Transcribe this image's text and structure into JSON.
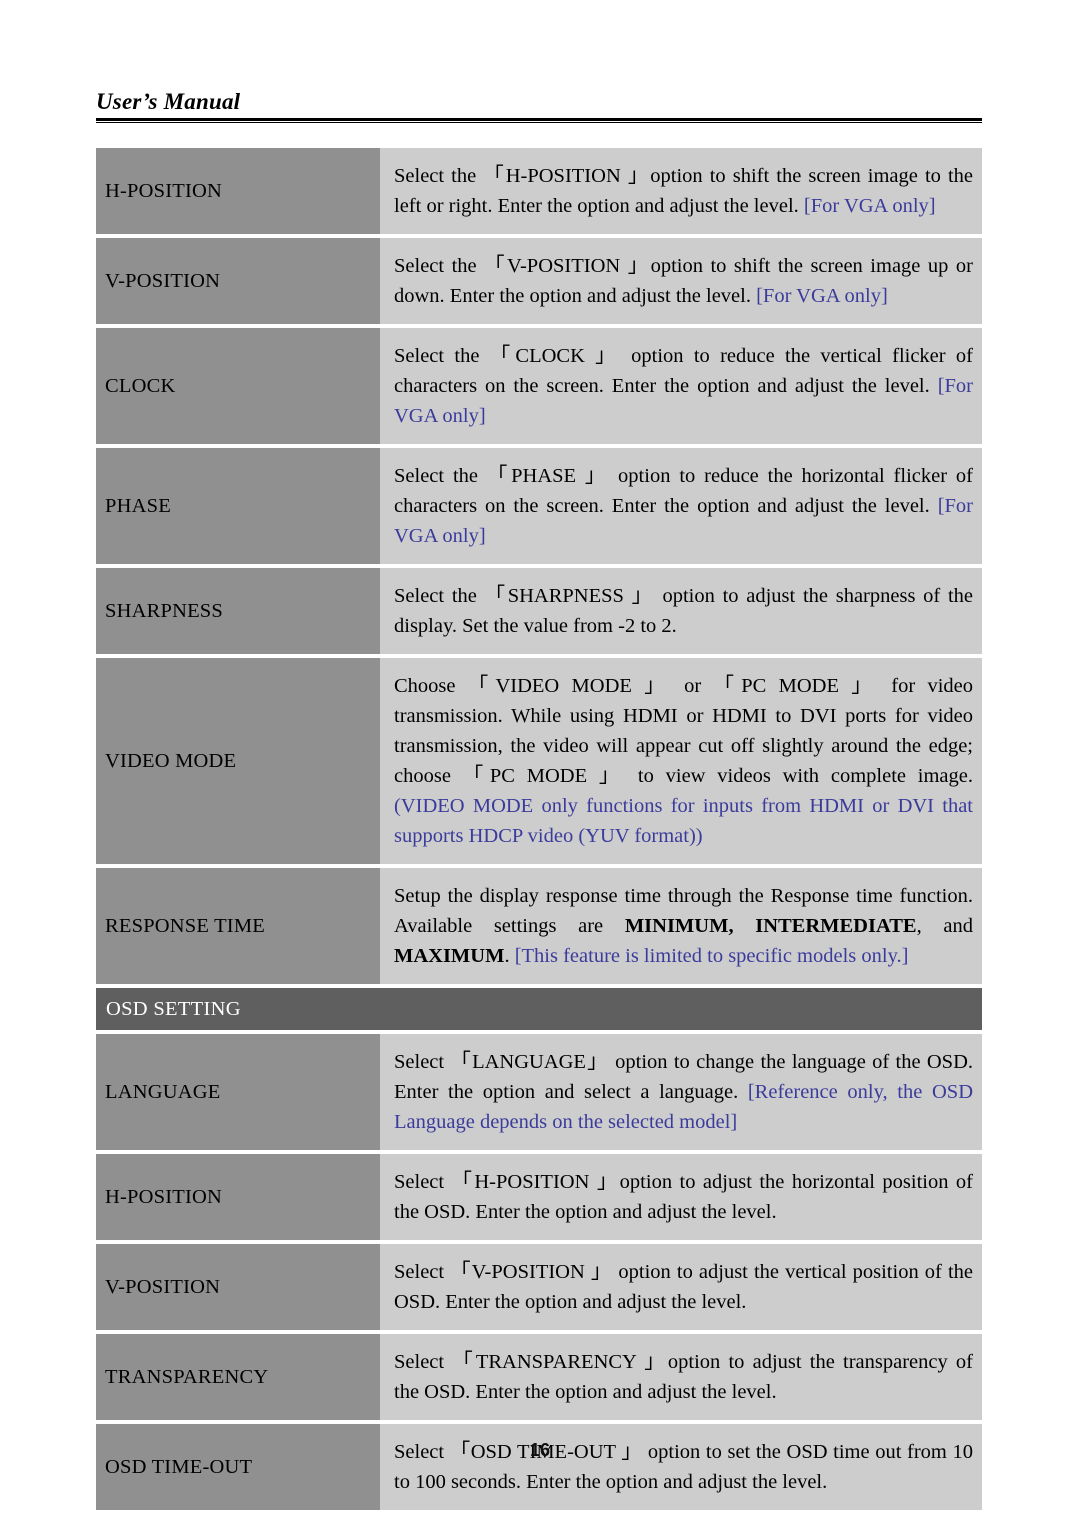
{
  "header": {
    "running_title": "User’s Manual"
  },
  "footer": {
    "page_number": "16"
  },
  "colors": {
    "label_cell_bg": "#909090",
    "desc_cell_bg": "#cdcdcd",
    "section_bar_bg": "#5f5f5f",
    "note_text": "#3b3b9c",
    "body_text": "#000000",
    "page_bg": "#ffffff"
  },
  "brackets": {
    "open": "「",
    "close": "」"
  },
  "table": {
    "rows": [
      {
        "label": "H-POSITION",
        "desc_parts": [
          {
            "text": "Select the ",
            "style": "plain"
          },
          {
            "text": "「H-POSITION 」",
            "style": "plain"
          },
          {
            "text": "option to shift the screen image to the left or right. Enter the option and adjust the level. ",
            "style": "plain"
          },
          {
            "text": "[For VGA only]",
            "style": "note"
          }
        ]
      },
      {
        "label": "V-POSITION",
        "desc_parts": [
          {
            "text": "Select the 「V-POSITION 」option to shift the screen image up or down. Enter the option and adjust the level. ",
            "style": "plain"
          },
          {
            "text": "[For VGA only]",
            "style": "note"
          }
        ]
      },
      {
        "label": "CLOCK",
        "desc_parts": [
          {
            "text": "Select the 「CLOCK 」 option to reduce the vertical flicker of characters on the screen. Enter the option and adjust the level. ",
            "style": "plain"
          },
          {
            "text": "[For VGA only]",
            "style": "note"
          }
        ]
      },
      {
        "label": "PHASE",
        "desc_parts": [
          {
            "text": "Select the 「PHASE 」 option to reduce the horizontal flicker of characters on the screen. Enter the option and adjust the level. ",
            "style": "plain"
          },
          {
            "text": "[For VGA only]",
            "style": "note"
          }
        ]
      },
      {
        "label": "SHARPNESS",
        "desc_parts": [
          {
            "text": "Select the 「SHARPNESS 」 option to adjust the sharpness of the display. Set the value from -2 to 2.",
            "style": "plain"
          }
        ]
      },
      {
        "label": "VIDEO MODE",
        "desc_parts": [
          {
            "text": "Choose 「VIDEO MODE 」 or  「PC MODE 」 for video transmission. While using HDMI or HDMI to DVI ports for video transmission, the video will appear cut off slightly around the edge; choose 「PC MODE 」 to view videos with complete image. ",
            "style": "plain"
          },
          {
            "text": "(VIDEO MODE only functions for inputs from HDMI or DVI that supports HDCP video (YUV format))",
            "style": "note"
          }
        ]
      },
      {
        "label": "RESPONSE TIME",
        "desc_parts": [
          {
            "text": "Setup the display response time through the Response time function. Available settings are ",
            "style": "plain"
          },
          {
            "text": "MINIMUM, INTERMEDIATE",
            "style": "bold"
          },
          {
            "text": ", and ",
            "style": "plain"
          },
          {
            "text": "MAXIMUM",
            "style": "bold"
          },
          {
            "text": ". ",
            "style": "plain"
          },
          {
            "text": "[This feature is limited to specific models only.]",
            "style": "note"
          }
        ]
      }
    ],
    "section_bar": {
      "label": "OSD SETTING"
    },
    "rows_osd": [
      {
        "label": "LANGUAGE",
        "desc_parts": [
          {
            "text": "Select 「LANGUAGE」  option to change the language of the OSD. Enter the option and select a language. ",
            "style": "plain"
          },
          {
            "text": "[Reference only, the OSD Language depends on the selected model]",
            "style": "note"
          }
        ]
      },
      {
        "label": "H-POSITION",
        "desc_parts": [
          {
            "text": "Select 「H-POSITION 」option to adjust the horizontal position of the OSD. Enter the option and adjust the level.",
            "style": "plain"
          }
        ]
      },
      {
        "label": "V-POSITION",
        "desc_parts": [
          {
            "text": "Select 「V-POSITION 」 option to adjust the vertical position of the OSD. Enter the option and adjust the level.",
            "style": "plain"
          }
        ]
      },
      {
        "label": "TRANSPARENCY",
        "desc_parts": [
          {
            "text": "Select 「TRANSPARENCY 」option to adjust the transparency of the OSD. Enter the option and adjust the level.",
            "style": "plain"
          }
        ]
      },
      {
        "label": "OSD TIME-OUT",
        "desc_parts": [
          {
            "text": "Select 「OSD TIME-OUT 」 option to set the OSD time out from 10 to 100 seconds. Enter the option and adjust the level.",
            "style": "plain"
          }
        ]
      }
    ]
  }
}
